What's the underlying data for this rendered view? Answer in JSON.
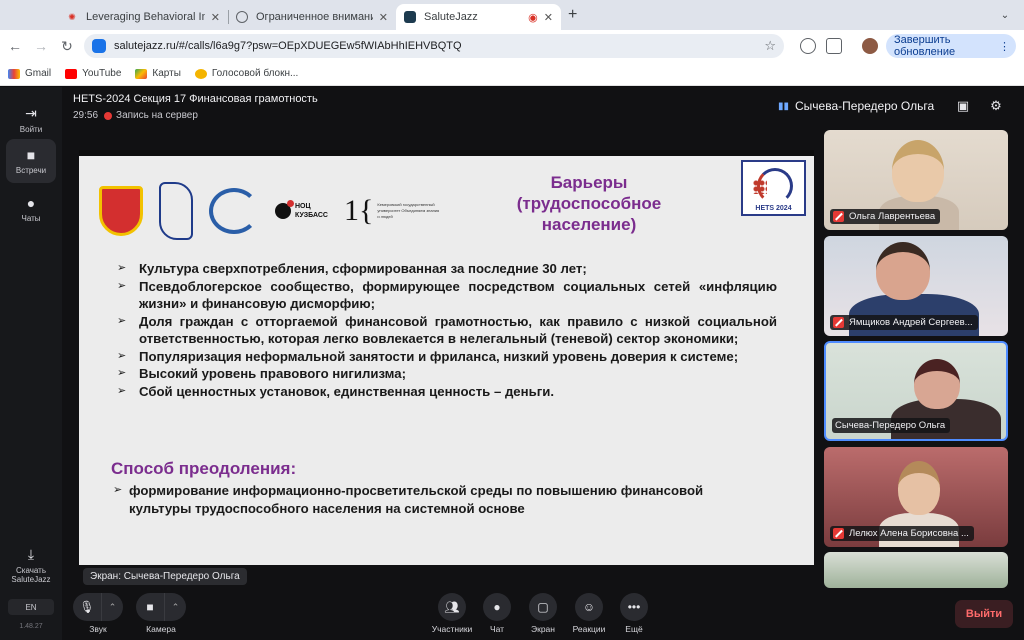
{
  "browser": {
    "tabs": [
      {
        "title": "Leveraging Behavioral Insight"
      },
      {
        "title": "Ограниченное внимание по"
      },
      {
        "title": "SaluteJazz"
      }
    ],
    "url": "salutejazz.ru/#/calls/l6a9g7?psw=OEpXDUEGEw5fWIAbHhIEHVBQTQ",
    "update_button": "Завершить обновление",
    "bookmarks": [
      "Gmail",
      "YouTube",
      "Карты",
      "Голосовой блокн..."
    ]
  },
  "sidebar": {
    "items": [
      {
        "label": "Войти",
        "icon": "login-icon"
      },
      {
        "label": "Встречи",
        "icon": "camera-icon"
      },
      {
        "label": "Чаты",
        "icon": "chat-icon"
      }
    ],
    "download_label_1": "Скачать",
    "download_label_2": "SaluteJazz",
    "lang": "EN",
    "version": "1.48.27"
  },
  "meeting": {
    "title": "HETS-2024 Секция 17 Финансовая грамотность",
    "timer": "29:56",
    "recording": "Запись на сервер",
    "active_speaker": "Сычева-Передеро Ольга",
    "screen_label": "Экран: Сычева-Передеро Ольга"
  },
  "slide": {
    "title_lines": [
      "Барьеры",
      "(трудоспособное",
      "население)"
    ],
    "nots": "НОЦ\nКУЗБАСС",
    "kemgu": "Кемеровский государственный университет Объединяем знания и людей",
    "hets_label": "HETS 2024",
    "bullets": [
      "Культура сверхпотребления, сформированная за последние 30 лет;",
      "Псевдоблогерское сообщество, формирующее посредством социальных сетей «инфляцию жизни» и финансовую дисморфию;",
      "Доля граждан с отторгаемой финансовой грамотностью, как правило с низкой социальной ответственностью, которая легко вовлекается в нелегальный (теневой) сектор экономики;",
      "Популяризация неформальной занятости и фриланса, низкий уровень доверия к системе;",
      "Высокий уровень правового нигилизма;",
      "Сбой ценностных установок, единственная ценность – деньги."
    ],
    "subtitle": "Способ преодоления:",
    "sub_item": "формирование информационно-просветительской среды по повышению финансовой культуры трудоспособного населения на системной основе"
  },
  "participants": [
    {
      "name": "Ольга Лаврентьева"
    },
    {
      "name": "Ямщиков Андрей Сергеев..."
    },
    {
      "name": "Сычева-Передеро Ольга"
    },
    {
      "name": "Лелюх Алена Борисовна ..."
    }
  ],
  "controls": {
    "sound": "Звук",
    "camera": "Камера",
    "participants": "Участники",
    "chat": "Чат",
    "screen": "Экран",
    "reactions": "Реакции",
    "more": "Ещё",
    "leave": "Выйти"
  }
}
